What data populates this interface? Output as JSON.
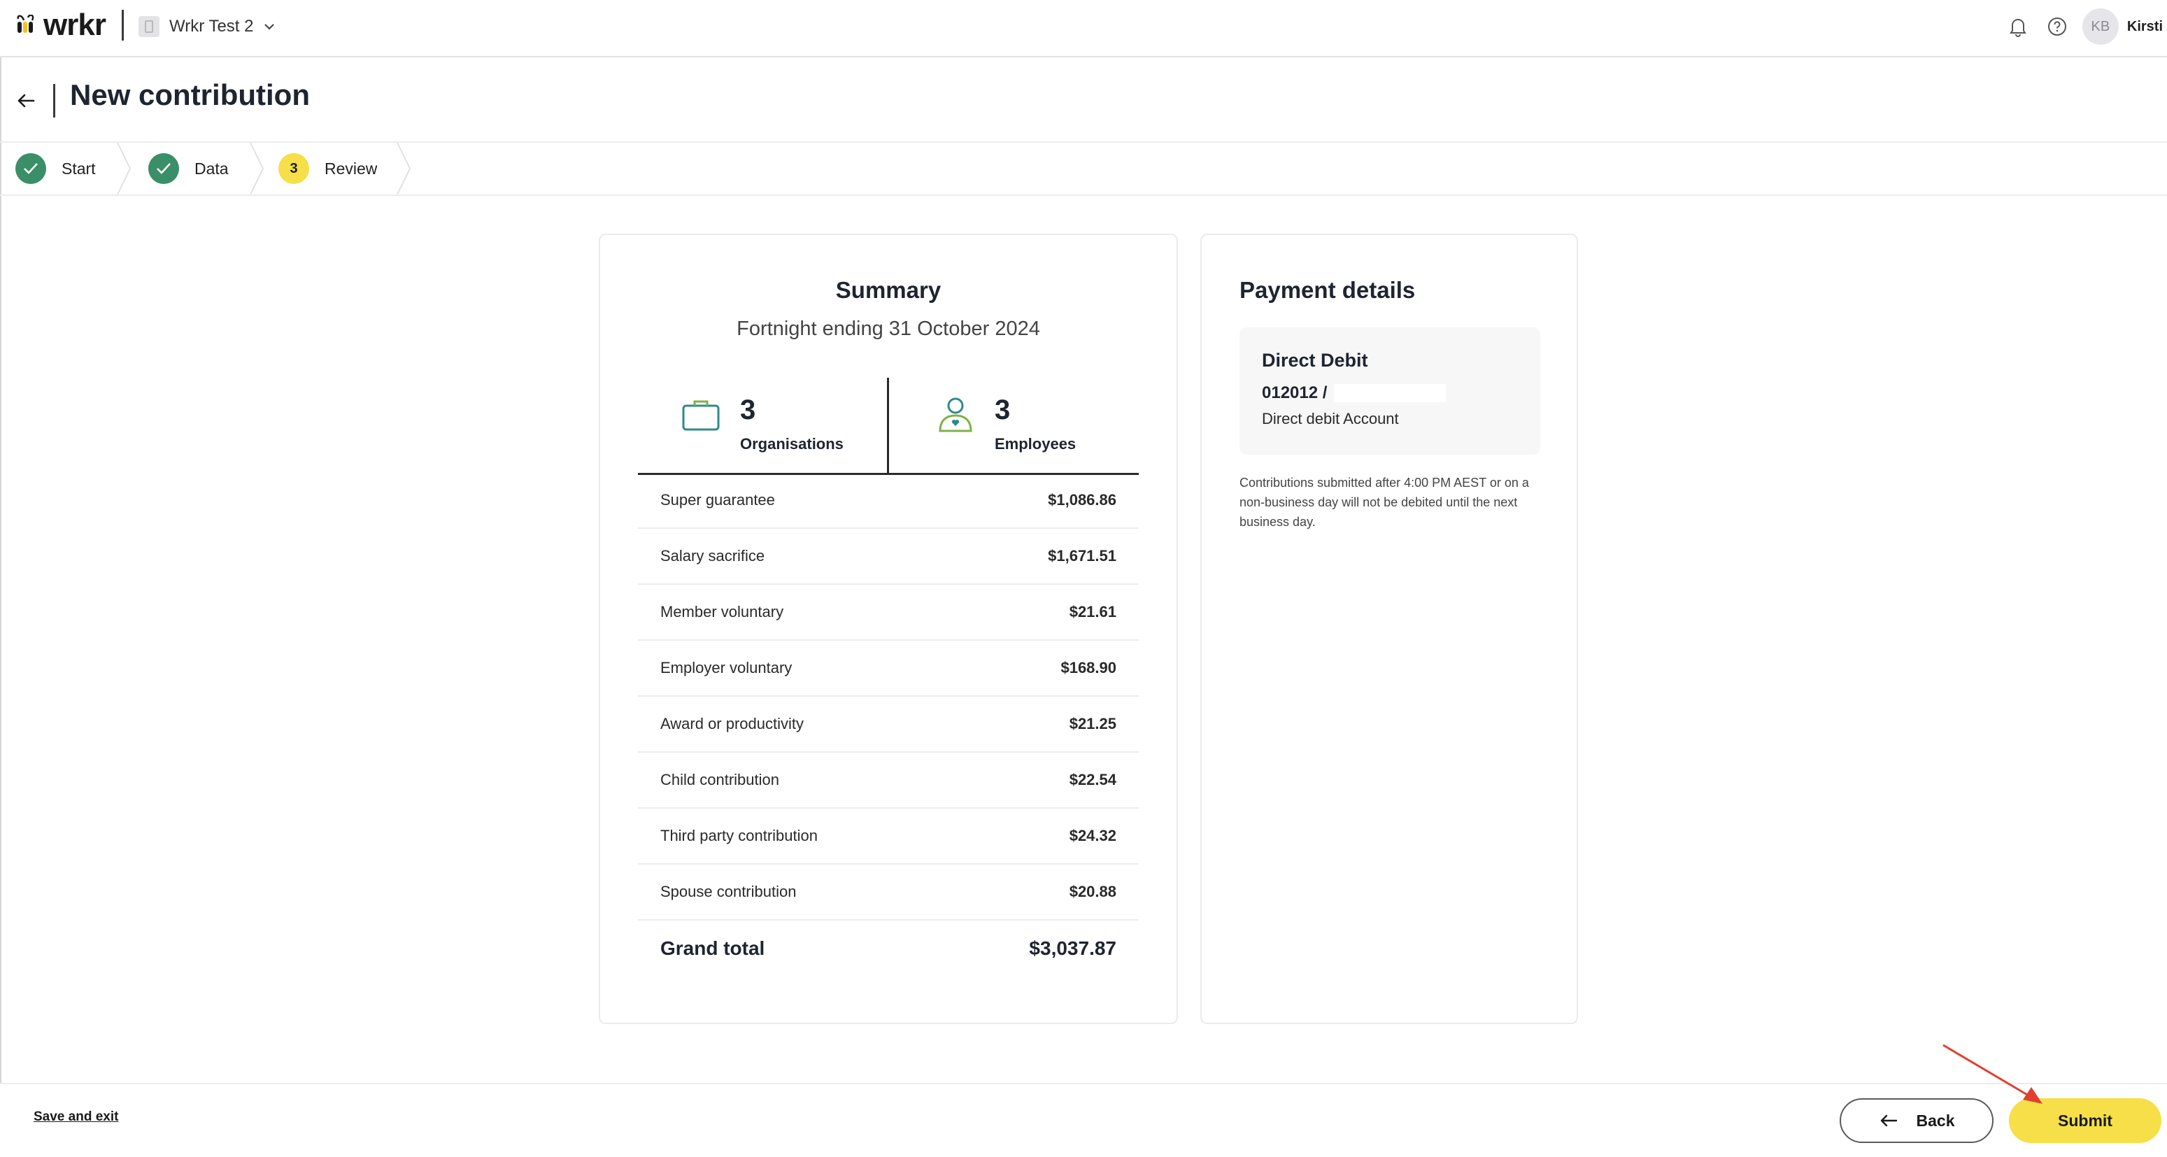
{
  "app": {
    "logo_text": "wrkr",
    "org_name": "Wrkr Test 2",
    "user_initials": "KB",
    "user_name": "Kirsti"
  },
  "header": {
    "title": "New contribution"
  },
  "stepper": {
    "steps": [
      {
        "label": "Start",
        "status": "done"
      },
      {
        "label": "Data",
        "status": "done"
      },
      {
        "label": "Review",
        "status": "current",
        "number": "3"
      }
    ]
  },
  "summary": {
    "title": "Summary",
    "period": "Fortnight ending 31 October 2024",
    "stats": {
      "organisations": {
        "value": "3",
        "label": "Organisations"
      },
      "employees": {
        "value": "3",
        "label": "Employees"
      }
    },
    "rows": [
      {
        "label": "Super guarantee",
        "value": "$1,086.86"
      },
      {
        "label": "Salary sacrifice",
        "value": "$1,671.51"
      },
      {
        "label": "Member voluntary",
        "value": "$21.61"
      },
      {
        "label": "Employer voluntary",
        "value": "$168.90"
      },
      {
        "label": "Award or productivity",
        "value": "$21.25"
      },
      {
        "label": "Child contribution",
        "value": "$22.54"
      },
      {
        "label": "Third party contribution",
        "value": "$24.32"
      },
      {
        "label": "Spouse contribution",
        "value": "$20.88"
      }
    ],
    "total": {
      "label": "Grand total",
      "value": "$3,037.87"
    }
  },
  "payment": {
    "title": "Payment details",
    "method": "Direct Debit",
    "account_prefix": "012012 /",
    "account_name": "Direct debit Account",
    "note": "Contributions submitted after 4:00 PM AEST or on a non-business day will not be debited until the next business day."
  },
  "footer": {
    "save_exit_label": "Save and exit",
    "back_label": "Back",
    "submit_label": "Submit"
  },
  "colors": {
    "accent_yellow": "#f6df48",
    "success_green": "#3b8f68",
    "annotation_red": "#e0412f"
  },
  "icons": {
    "logo": "bee-icon",
    "notifications": "bell-icon",
    "help": "help-icon",
    "back": "arrow-left-icon",
    "organisations": "briefcase-icon",
    "employees": "person-icon"
  }
}
